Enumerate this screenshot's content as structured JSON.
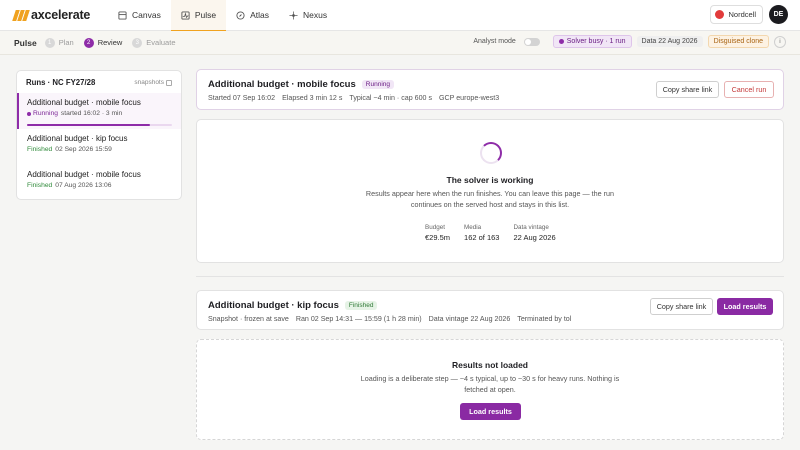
{
  "brand": {
    "name": "axcelerate"
  },
  "nav": {
    "tabs": [
      {
        "label": "Canvas",
        "icon": "canvas-icon"
      },
      {
        "label": "Pulse",
        "icon": "pulse-icon"
      },
      {
        "label": "Atlas",
        "icon": "compass-icon"
      },
      {
        "label": "Nexus",
        "icon": "nexus-icon"
      }
    ],
    "active_tab": "Pulse",
    "org": "Nordcell",
    "avatar_initials": "DE"
  },
  "subnav": {
    "title": "Pulse",
    "steps": [
      {
        "num": "1",
        "label": "Plan"
      },
      {
        "num": "2",
        "label": "Review"
      },
      {
        "num": "3",
        "label": "Evaluate"
      }
    ],
    "analyst_mode_label": "Analyst mode",
    "analyst_mode_on": false,
    "solver_status": "Solver busy · 1 run",
    "data_date": "Data 22 Aug 2026",
    "clone_badge": "Disguised clone",
    "info_glyph": "i"
  },
  "sidebar": {
    "title": "Runs · NC FY27/28",
    "snapshots_label": "snapshots",
    "runs": [
      {
        "name": "Additional budget · mobile focus",
        "status": "Running",
        "detail": "started 16:02 · 3 min",
        "progress": 0.85
      },
      {
        "name": "Additional budget · kip focus",
        "status": "Finished",
        "detail": "02 Sep 2026 15:59"
      },
      {
        "name": "Additional budget · mobile focus",
        "status": "Finished",
        "detail": "07 Aug 2026 13:06"
      }
    ]
  },
  "current_run": {
    "title": "Additional budget · mobile focus",
    "status": "Running",
    "meta": [
      "Started 07 Sep 16:02",
      "Elapsed 3 min 12 s",
      "Typical ~4 min · cap 600 s",
      "GCP europe-west3"
    ],
    "copy_link_label": "Copy share link",
    "cancel_label": "Cancel run"
  },
  "solver": {
    "title": "The solver is working",
    "text": "Results appear here when the run finishes. You can leave this page — the run continues on the served host and stays in this list.",
    "stats": [
      {
        "label": "Budget",
        "value": "€29.5m"
      },
      {
        "label": "Media",
        "value": "162 of 163"
      },
      {
        "label": "Data vintage",
        "value": "22 Aug 2026"
      }
    ]
  },
  "snapshot_run": {
    "title": "Additional budget · kip focus",
    "status": "Finished",
    "meta": [
      "Snapshot · frozen at save",
      "Ran 02 Sep 14:31 — 15:59 (1 h 28 min)",
      "Data vintage 22 Aug 2026",
      "Terminated by tol"
    ],
    "copy_link_label": "Copy share link",
    "load_label": "Load results"
  },
  "not_loaded": {
    "title": "Results not loaded",
    "text": "Loading is a deliberate step — ~4 s typical, up to ~30 s for heavy runs. Nothing is fetched at open.",
    "load_label": "Load results"
  },
  "colors": {
    "accent": "#8e2ca8",
    "brand_orange": "#f0a21f",
    "finished_green": "#2f8a3a",
    "danger": "#c43a3a"
  }
}
